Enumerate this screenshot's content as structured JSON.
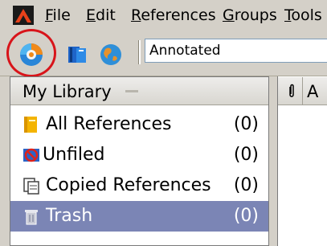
{
  "menu": {
    "items": [
      {
        "label": "File",
        "underline": "F",
        "rest": "ile"
      },
      {
        "label": "Edit",
        "underline": "E",
        "rest": "dit"
      },
      {
        "label": "References",
        "underline": "R",
        "rest": "eferences"
      },
      {
        "label": "Groups",
        "underline": "G",
        "rest": "roups"
      },
      {
        "label": "Tools",
        "underline": "T",
        "rest": "ools"
      }
    ]
  },
  "toolbar": {
    "buttons": [
      {
        "name": "new-library-button",
        "icon": "orange-gear-globe-icon"
      },
      {
        "name": "add-reference-button",
        "icon": "book-icon"
      },
      {
        "name": "online-search-button",
        "icon": "globe-icon"
      }
    ],
    "style_select": {
      "value": "Annotated"
    }
  },
  "collections": {
    "header": "My Library",
    "items": [
      {
        "label": "All References",
        "count": "(0)",
        "icon": "folder-icon",
        "selected": false
      },
      {
        "label": "Unfiled",
        "count": "(0)",
        "icon": "unfiled-icon",
        "selected": false
      },
      {
        "label": "Copied References",
        "count": "(0)",
        "icon": "copied-references-icon",
        "selected": false
      },
      {
        "label": "Trash",
        "count": "(0)",
        "icon": "trash-icon",
        "selected": true
      }
    ]
  },
  "items_pane": {
    "columns": [
      {
        "label": "",
        "icon": "paperclip-icon"
      },
      {
        "label": "A"
      }
    ]
  },
  "colors": {
    "accent_ring": "#d8141a",
    "selection": "#7b85b5"
  }
}
